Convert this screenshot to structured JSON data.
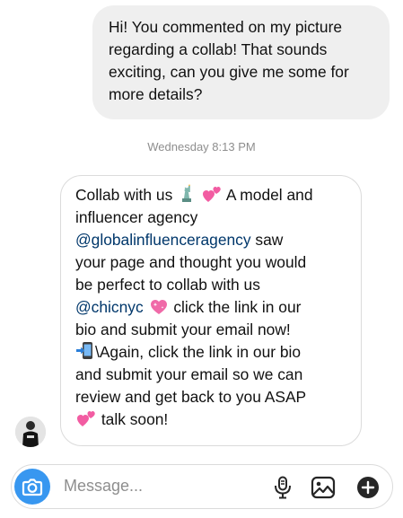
{
  "conversation": {
    "outgoing_message": "Hi! You commented on my picture regarding a collab! That sounds exciting, can you give me some for more details?",
    "timestamp": "Wednesday 8:13 PM",
    "incoming": {
      "line1_prefix": "Collab with us",
      "line1_suffix": "A model and",
      "line2": "influencer agency",
      "mention1": "@globalinfluenceragency",
      "after_mention1": " saw",
      "line4": "your page and thought you would",
      "line5": "be perfect to collab with us",
      "mention2": "@chicnyc",
      "after_mention2": " click the link in our",
      "line7": "bio and submit your email now!",
      "line8_suffix": "\\Again, click the link in our bio",
      "line9": "and submit your email so we can",
      "line10": "review and get back to you ASAP",
      "line11_suffix": " talk soon!"
    },
    "icons": {
      "liberty": "statue-of-liberty-icon",
      "hearts": "two-hearts-icon",
      "sparkle_heart": "sparkling-heart-icon",
      "phone_arrow": "mobile-phone-arrow-icon"
    }
  },
  "composer": {
    "placeholder": "Message...",
    "accent_color": "#3897f0"
  }
}
